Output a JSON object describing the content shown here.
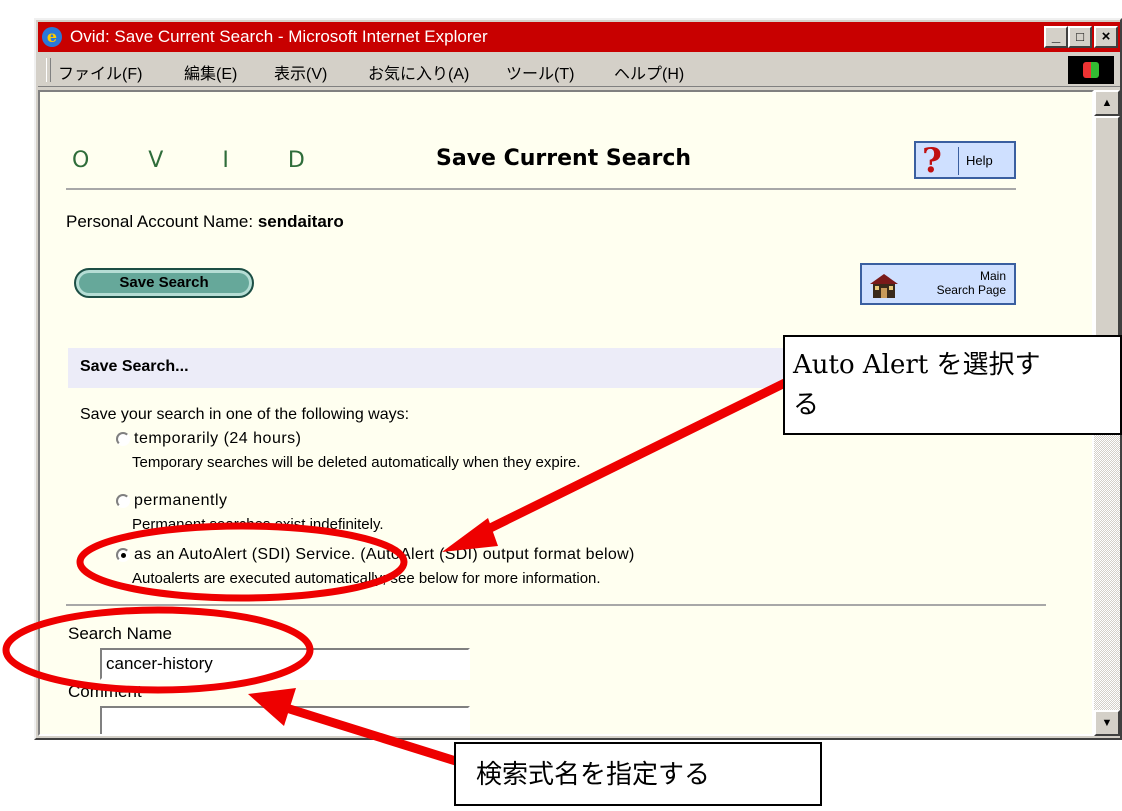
{
  "window": {
    "title": "Ovid: Save Current Search - Microsoft Internet Explorer",
    "buttons": {
      "minimize": "_",
      "maximize": "□",
      "close": "×"
    }
  },
  "menubar": {
    "items": [
      "ファイル(F)",
      "編集(E)",
      "表示(V)",
      "お気に入り(A)",
      "ツール(T)",
      "ヘルプ(H)"
    ]
  },
  "header": {
    "logo": "O V I D",
    "title": "Save Current Search",
    "help_label": "Help",
    "help_glyph": "?"
  },
  "account": {
    "label": "Personal Account Name: ",
    "name": "sendaitaro"
  },
  "buttons": {
    "save_search": "Save Search",
    "main_search_line1": "Main",
    "main_search_line2": "Search Page"
  },
  "save_section": {
    "heading": "Save Search...",
    "intro": "Save your search in one of the following ways:",
    "options": [
      {
        "label": "temporarily (24 hours)",
        "desc": "Temporary searches will be deleted automatically when they expire.",
        "checked": false
      },
      {
        "label": "permanently",
        "desc": "Permanent searches exist indefinitely.",
        "checked": false
      },
      {
        "label": "as an AutoAlert (SDI) Service. (AutoAlert (SDI) output format below)",
        "desc": "Autoalerts are executed automatically; see below for more information.",
        "checked": true
      }
    ]
  },
  "form": {
    "search_name_label": "Search Name",
    "search_name_value": "cancer-history",
    "comment_label": "Comment",
    "comment_value": ""
  },
  "annotations": {
    "callout_autoalert": "Auto Alert を選択する",
    "callout_autoalert_line1": "Auto Alert を選択す",
    "callout_autoalert_line2": "る",
    "callout_searchname": "検索式名を指定する",
    "color": "#ee0000"
  }
}
